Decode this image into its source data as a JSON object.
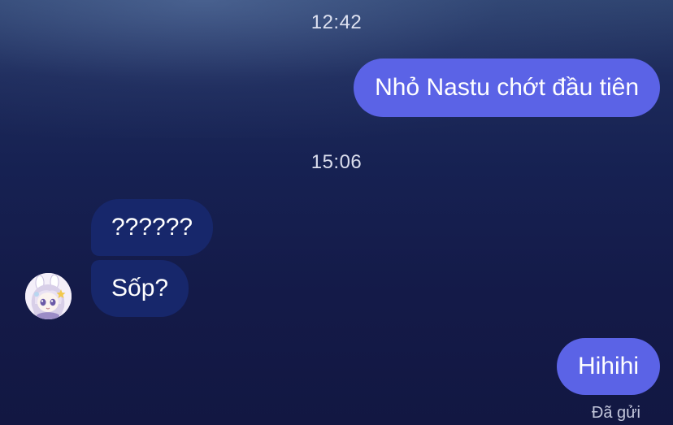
{
  "conversation": {
    "messages": [
      {
        "time": "12:42"
      },
      {
        "sender": "me",
        "text": "Nhỏ Nastu chớt đầu tiên"
      },
      {
        "time": "15:06"
      },
      {
        "sender": "contact",
        "text": "??????"
      },
      {
        "sender": "contact",
        "text": "Sốp?"
      },
      {
        "sender": "me",
        "text": "Hihihi"
      }
    ],
    "delivery_status": "Đã gửi"
  },
  "contact": {
    "avatar_icon": "anime-girl-avatar-icon"
  },
  "colors": {
    "outgoing_bubble": "#5b63e6",
    "incoming_bubble": "#17276b",
    "background_top": "#2f4470",
    "background_bottom": "#121742"
  }
}
